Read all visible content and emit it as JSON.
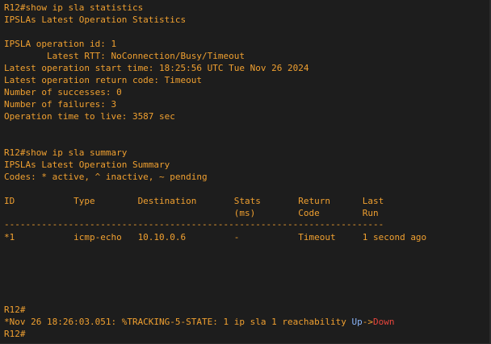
{
  "terminal": {
    "colors": {
      "background": "#1d1d1d",
      "text": "#f0a030",
      "up": "#8ab4f8",
      "down": "#e8453c"
    },
    "stats": {
      "command": "R12#show ip sla statistics",
      "header": "IPSLAs Latest Operation Statistics",
      "operation_id": "IPSLA operation id: 1",
      "latest_rtt": "        Latest RTT: NoConnection/Busy/Timeout",
      "start_time": "Latest operation start time: 18:25:56 UTC Tue Nov 26 2024",
      "return_code": "Latest operation return code: Timeout",
      "successes": "Number of successes: 0",
      "failures": "Number of failures: 3",
      "time_to_live": "Operation time to live: 3587 sec"
    },
    "summary": {
      "command": "R12#show ip sla summary",
      "header": "IPSLAs Latest Operation Summary",
      "codes": "Codes: * active, ^ inactive, ~ pending",
      "columns_line1": "ID           Type        Destination       Stats       Return      Last",
      "columns_line2": "                                           (ms)        Code        Run",
      "separator": "-----------------------------------------------------------------------",
      "rows": [
        "*1           icmp-echo   10.10.0.6         -           Timeout     1 second ago"
      ]
    },
    "log": {
      "prompt1": "R12#",
      "message_prefix": "*Nov 26 18:26:03.051: %TRACKING-5-STATE: 1 ip sla 1 reachability ",
      "state_up": "Up",
      "arrow": "->",
      "state_down": "Down",
      "prompt2": "R12#"
    }
  }
}
